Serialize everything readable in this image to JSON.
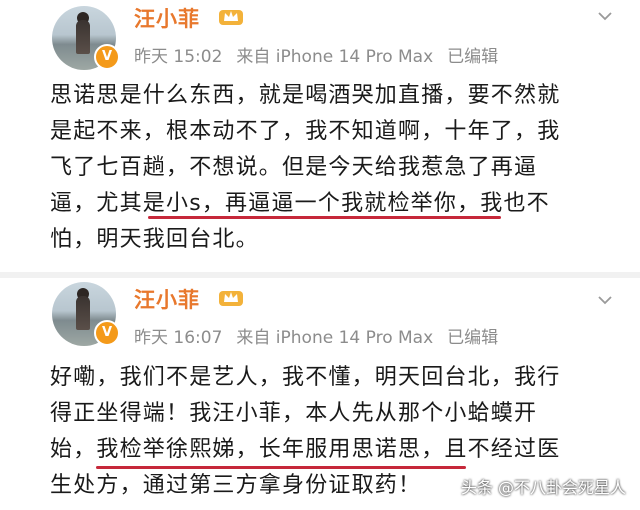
{
  "posts": [
    {
      "username": "汪小菲",
      "badge": "V",
      "time": "昨天 15:02",
      "source": "来自 iPhone 14 Pro Max",
      "edited": "已编辑",
      "lines": [
        "思诺思是什么东西，就是喝酒哭加直播，要不然就",
        "是起不来，根本动不了，我不知道啊，十年了，我",
        "飞了七百趟，不想说。但是今天给我惹急了再逼",
        "逼，尤其是小s，再逼逼一个我就检举你，我也不",
        "怕，明天我回台北。"
      ]
    },
    {
      "username": "汪小菲",
      "badge": "V",
      "time": "昨天 16:07",
      "source": "来自 iPhone 14 Pro Max",
      "edited": "已编辑",
      "lines": [
        "好嘞，我们不是艺人，我不懂，明天回台北，我行",
        "得正坐得端！我汪小菲，本人先从那个小蛤蟆开",
        "始，我检举徐熙娣，长年服用思诺思，且不经过医",
        "生处方，通过第三方拿身份证取药！"
      ]
    }
  ],
  "watermark": "头条 @不八卦会死星人",
  "colors": {
    "username": "#e8782d",
    "underline": "#c6283a",
    "meta": "#8c8c8c",
    "badge": "#f49a1a"
  },
  "icons": [
    "crown-icon",
    "chevron-down-icon",
    "verified-badge-icon"
  ]
}
